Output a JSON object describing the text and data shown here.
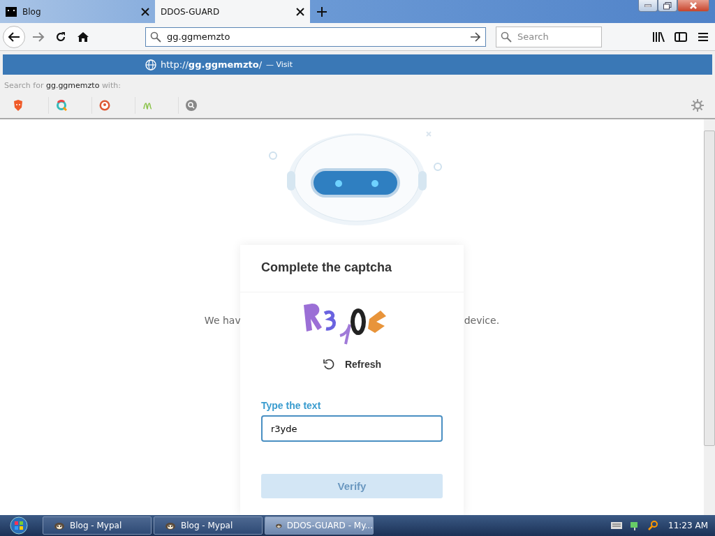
{
  "tabs": [
    {
      "label": "Blog",
      "selected": false,
      "kind": "site"
    },
    {
      "label": "DDOS-GUARD",
      "selected": true,
      "kind": "plain"
    }
  ],
  "address": {
    "value": "gg.ggmemzto"
  },
  "search": {
    "placeholder": "Search"
  },
  "suggestion": {
    "url": "http://**gg.ggmemzto**/",
    "action": "— Visit"
  },
  "search_for": {
    "prefix": "Search for",
    "query": "gg.ggmemzto",
    "suffix": "with:"
  },
  "page": {
    "text_left": "We hav",
    "text_right": "device.",
    "captcha": {
      "title": "Complete the captcha",
      "refresh": "Refresh",
      "label": "Type the text",
      "value": "r3yde",
      "verify": "Verify",
      "verify_disabled": true
    }
  },
  "taskbar": {
    "items": [
      {
        "label": "Blog - Mypal",
        "selected": false
      },
      {
        "label": "Blog - Mypal",
        "selected": false
      },
      {
        "label": "DDOS-GUARD - My...",
        "selected": true
      }
    ],
    "clock": "11:23 AM"
  }
}
